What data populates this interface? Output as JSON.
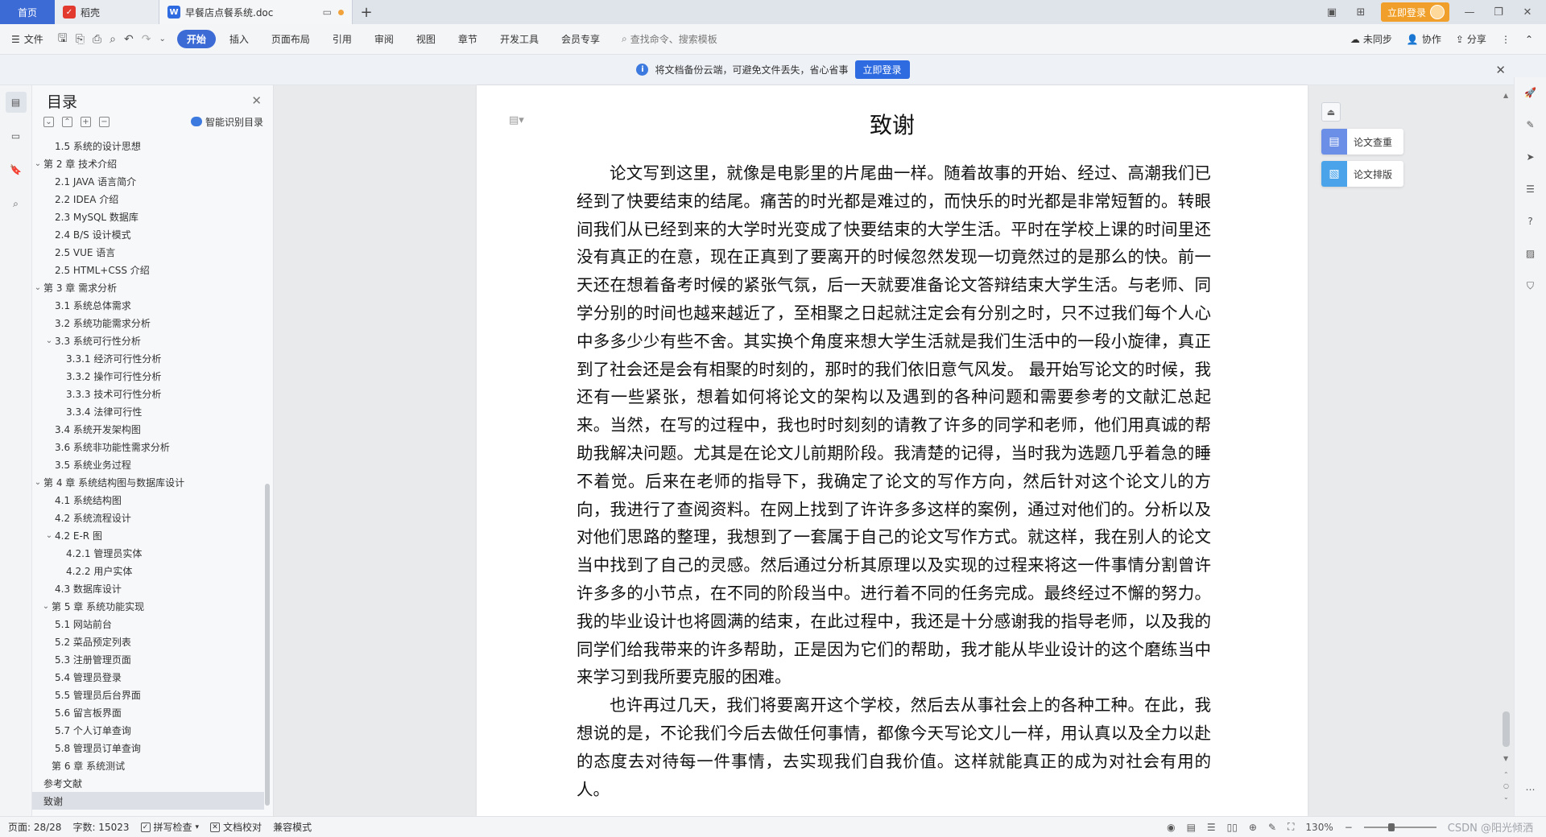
{
  "titlebar": {
    "home_tab": "首页",
    "tabs": [
      {
        "label": "稻壳"
      },
      {
        "label": "早餐店点餐系统.doc"
      }
    ],
    "new_tab": "+",
    "login_button": "立即登录"
  },
  "ribbon": {
    "file_menu": "文件",
    "menus": [
      "开始",
      "插入",
      "页面布局",
      "引用",
      "审阅",
      "视图",
      "章节",
      "开发工具",
      "会员专享"
    ],
    "active_menu": "开始",
    "search_placeholder": "查找命令、搜索模板",
    "unsynced": "未同步",
    "collaborate": "协作",
    "share": "分享"
  },
  "notify": {
    "text": "将文档备份云端，可避免文件丢失，省心省事",
    "button": "立即登录"
  },
  "toc": {
    "title": "目录",
    "smart_label": "智能识别目录",
    "items": [
      {
        "label": "1.5 系统的设计思想",
        "level": 2,
        "caret": ""
      },
      {
        "label": "第 2 章   技术介绍",
        "level": 1,
        "caret": "v"
      },
      {
        "label": "2.1 JAVA 语言简介",
        "level": 2,
        "caret": ""
      },
      {
        "label": "2.2 IDEA 介绍",
        "level": 2,
        "caret": ""
      },
      {
        "label": "2.3 MySQL 数据库",
        "level": 2,
        "caret": ""
      },
      {
        "label": "2.4 B/S 设计模式",
        "level": 2,
        "caret": ""
      },
      {
        "label": "2.5 VUE 语言",
        "level": 2,
        "caret": ""
      },
      {
        "label": "2.5 HTML+CSS 介绍",
        "level": 2,
        "caret": ""
      },
      {
        "label": "第 3 章  需求分析",
        "level": 1,
        "caret": "v"
      },
      {
        "label": "3.1   系统总体需求",
        "level": 2,
        "caret": ""
      },
      {
        "label": "3.2   系统功能需求分析",
        "level": 2,
        "caret": ""
      },
      {
        "label": "3.3     系统可行性分析",
        "level": 2,
        "caret": "v"
      },
      {
        "label": "3.3.1  经济可行性分析",
        "level": 3,
        "caret": ""
      },
      {
        "label": "3.3.2 操作可行性分析",
        "level": 3,
        "caret": ""
      },
      {
        "label": "3.3.3 技术可行性分析",
        "level": 3,
        "caret": ""
      },
      {
        "label": "3.3.4 法律可行性",
        "level": 3,
        "caret": ""
      },
      {
        "label": "3.4     系统开发架构图",
        "level": 2,
        "caret": ""
      },
      {
        "label": "3.6     系统非功能性需求分析",
        "level": 2,
        "caret": ""
      },
      {
        "label": "3.5     系统业务过程",
        "level": 2,
        "caret": ""
      },
      {
        "label": "第 4 章    系统结构图与数据库设计",
        "level": 1,
        "caret": "v"
      },
      {
        "label": "4.1  系统结构图",
        "level": 2,
        "caret": ""
      },
      {
        "label": "4.2  系统流程设计",
        "level": 2,
        "caret": ""
      },
      {
        "label": "4.2 E-R 图",
        "level": 2,
        "caret": "v"
      },
      {
        "label": "4.2.1  管理员实体",
        "level": 3,
        "caret": ""
      },
      {
        "label": "4.2.2  用户实体",
        "level": 3,
        "caret": ""
      },
      {
        "label": "4.3  数据库设计",
        "level": 2,
        "caret": ""
      },
      {
        "label": "第 5 章     系统功能实现",
        "level": 1,
        "caret": "v",
        "indent": true
      },
      {
        "label": "5.1  网站前台",
        "level": 2,
        "caret": ""
      },
      {
        "label": "5.2  菜品预定列表",
        "level": 2,
        "caret": ""
      },
      {
        "label": "5.3  注册管理页面",
        "level": 2,
        "caret": ""
      },
      {
        "label": "5.4  管理员登录",
        "level": 2,
        "caret": ""
      },
      {
        "label": "5.5  管理员后台界面",
        "level": 2,
        "caret": ""
      },
      {
        "label": "5.6  留言板界面",
        "level": 2,
        "caret": ""
      },
      {
        "label": "5.7  个人订单查询",
        "level": 2,
        "caret": ""
      },
      {
        "label": "5.8  管理员订单查询",
        "level": 2,
        "caret": ""
      },
      {
        "label": "第 6 章    系统测试",
        "level": 1,
        "caret": "",
        "indent": true
      },
      {
        "label": "参考文献",
        "level": 1,
        "caret": ""
      },
      {
        "label": "致谢",
        "level": 1,
        "caret": "",
        "selected": true
      }
    ]
  },
  "document": {
    "title": "致谢",
    "paragraphs": [
      "论文写到这里，就像是电影里的片尾曲一样。随着故事的开始、经过、高潮我们已经到了快要结束的结尾。痛苦的时光都是难过的，而快乐的时光都是非常短暂的。转眼间我们从已经到来的大学时光变成了快要结束的大学生活。平时在学校上课的时间里还没有真正的在意，现在正真到了要离开的时候忽然发现一切竟然过的是那么的快。前一天还在想着备考时候的紧张气氛，后一天就要准备论文答辩结束大学生活。与老师、同学分别的时间也越来越近了，至相聚之日起就注定会有分别之时，只不过我们每个人心中多多少少有些不舍。其实换个角度来想大学生活就是我们生活中的一段小旋律，真正到了社会还是会有相聚的时刻的，那时的我们依旧意气风发。   最开始写论文的时候，我还有一些紧张，想着如何将论文的架构以及遇到的各种问题和需要参考的文献汇总起来。当然，在写的过程中，我也时时刻刻的请教了许多的同学和老师，他们用真诚的帮助我解决问题。尤其是在论文儿前期阶段。我清楚的记得，当时我为选题几乎着急的睡不着觉。后来在老师的指导下，我确定了论文的写作方向，然后针对这个论文儿的方向，我进行了查阅资料。在网上找到了许许多多这样的案例，通过对他们的。分析以及对他们思路的整理，我想到了一套属于自己的论文写作方式。就这样，我在别人的论文当中找到了自己的灵感。然后通过分析其原理以及实现的过程来将这一件事情分割曾许许多多的小节点，在不同的阶段当中。进行着不同的任务完成。最终经过不懈的努力。我的毕业设计也将圆满的结束，在此过程中，我还是十分感谢我的指导老师，以及我的同学们给我带来的许多帮助，正是因为它们的帮助，我才能从毕业设计的这个磨练当中来学习到我所要克服的困难。",
      "也许再过几天，我们将要离开这个学校，然后去从事社会上的各种工种。在此，我想说的是，不论我们今后去做任何事情，都像今天写论文儿一样，用认真以及全力以赴的态度去对待每一件事情，去实现我们自我价值。这样就能真正的成为对社会有用的人。"
    ]
  },
  "float": {
    "check": "论文查重",
    "format": "论文排版"
  },
  "status": {
    "page": "页面: 28/28",
    "words": "字数: 15023",
    "spell": "拼写检查",
    "proof": "文档校对",
    "compat": "兼容模式",
    "zoom": "130%",
    "watermark": "CSDN @阳光倾洒"
  }
}
